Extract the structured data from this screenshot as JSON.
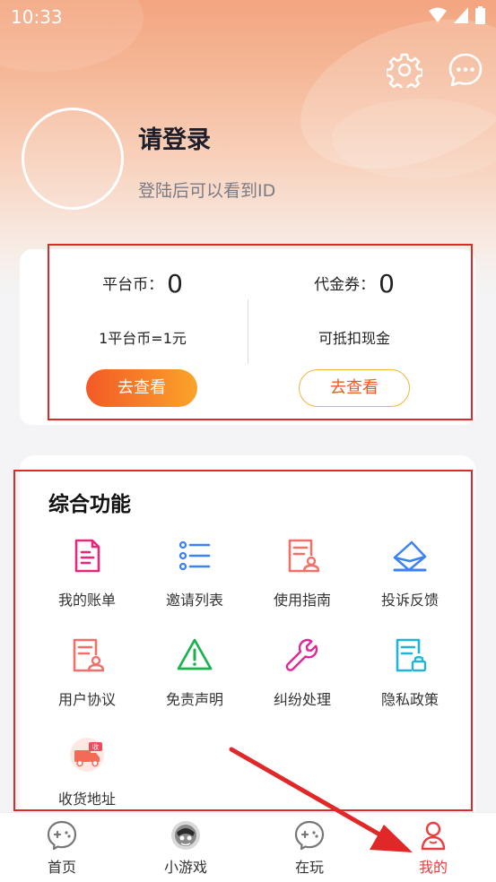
{
  "status_bar": {
    "time": "10:33"
  },
  "header": {
    "login_title": "请登录",
    "login_subtitle": "登陆后可以看到ID"
  },
  "wallet": {
    "left": {
      "label": "平台币：",
      "value": "0",
      "desc": "1平台币=1元",
      "button": "去查看"
    },
    "right": {
      "label": "代金券：",
      "value": "0",
      "desc": "可抵扣现金",
      "button": "去查看"
    }
  },
  "functions": {
    "title": "综合功能",
    "items": [
      {
        "label": "我的账单",
        "icon": "bill-icon"
      },
      {
        "label": "邀请列表",
        "icon": "list-icon"
      },
      {
        "label": "使用指南",
        "icon": "guide-icon"
      },
      {
        "label": "投诉反馈",
        "icon": "feedback-icon"
      },
      {
        "label": "用户协议",
        "icon": "agreement-icon"
      },
      {
        "label": "免责声明",
        "icon": "warning-icon"
      },
      {
        "label": "纠纷处理",
        "icon": "wrench-icon"
      },
      {
        "label": "隐私政策",
        "icon": "privacy-lock-icon"
      },
      {
        "label": "收货地址",
        "icon": "delivery-truck-icon",
        "badge": "收"
      }
    ]
  },
  "bottom_nav": {
    "items": [
      {
        "label": "首页",
        "icon": "gamepad-icon"
      },
      {
        "label": "小游戏",
        "icon": "mini-game-icon"
      },
      {
        "label": "在玩",
        "icon": "gamepad-icon"
      },
      {
        "label": "我的",
        "icon": "user-icon",
        "active": true
      }
    ]
  },
  "colors": {
    "accent_red": "#ee3b3b",
    "button_gradient_start": "#f35a26",
    "button_gradient_end": "#fba32a",
    "annotation_red": "#e02828"
  }
}
